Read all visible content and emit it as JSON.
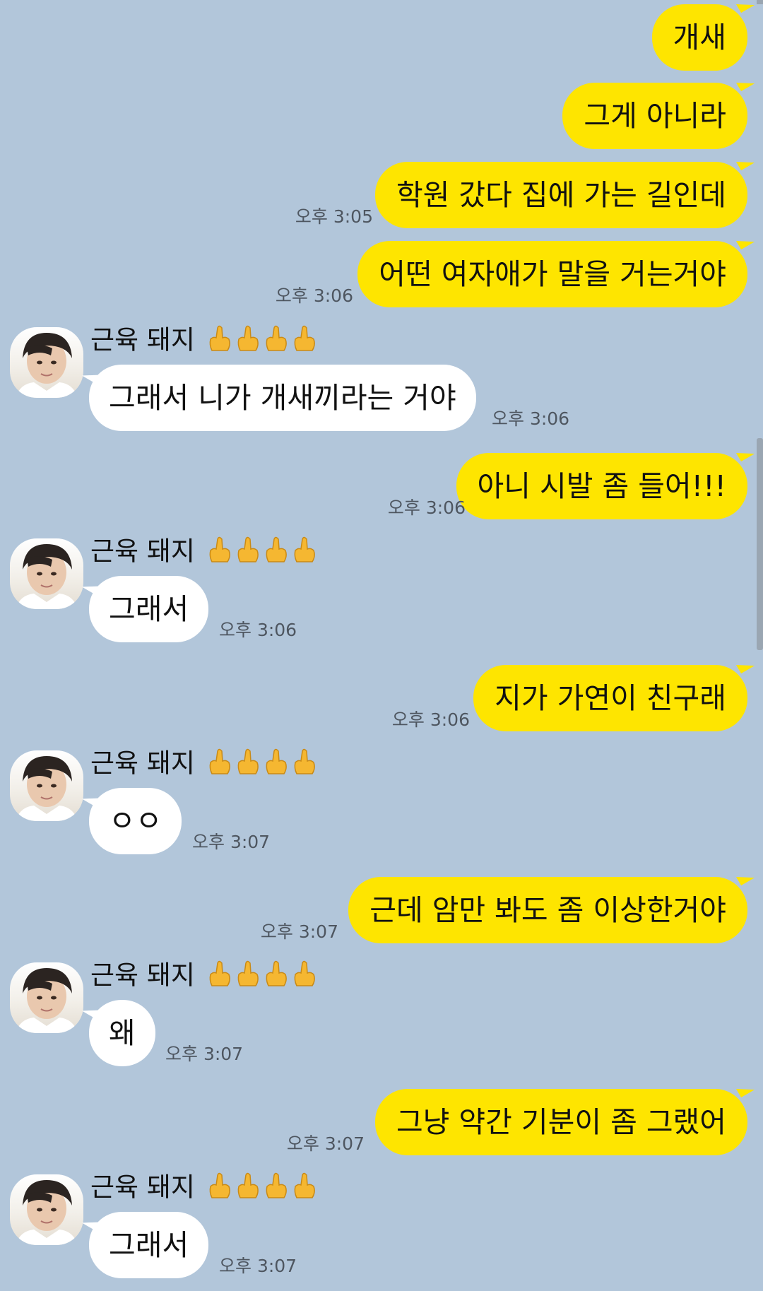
{
  "contact": {
    "name": "근육 돼지",
    "name_emoji": "middle-finger-emoji"
  },
  "messages": [
    {
      "from": "me",
      "text": "개새",
      "time": ""
    },
    {
      "from": "me",
      "text": "그게 아니라",
      "time": ""
    },
    {
      "from": "me",
      "text": "학원 갔다 집에 가는 길인데",
      "time": "오후 3:05"
    },
    {
      "from": "me",
      "text": "어떤 여자애가 말을 거는거야",
      "time": "오후 3:06"
    },
    {
      "from": "them",
      "text": "그래서 니가 개새끼라는 거야",
      "time": "오후 3:06"
    },
    {
      "from": "me",
      "text": "아니 시발 좀 들어!!!",
      "time": "오후 3:06"
    },
    {
      "from": "them",
      "text": "그래서",
      "time": "오후 3:06"
    },
    {
      "from": "me",
      "text": "지가 가연이 친구래",
      "time": "오후 3:06"
    },
    {
      "from": "them",
      "text": "ㅇㅇ",
      "time": "오후 3:07"
    },
    {
      "from": "me",
      "text": "근데 암만 봐도 좀 이상한거야",
      "time": "오후 3:07"
    },
    {
      "from": "them",
      "text": "왜",
      "time": "오후 3:07"
    },
    {
      "from": "me",
      "text": "그냥 약간 기분이 좀 그랬어",
      "time": "오후 3:07"
    },
    {
      "from": "them",
      "text": "그래서",
      "time": "오후 3:07"
    }
  ],
  "colors": {
    "background": "#b2c6da",
    "sent_bubble": "#fee500",
    "received_bubble": "#ffffff"
  }
}
